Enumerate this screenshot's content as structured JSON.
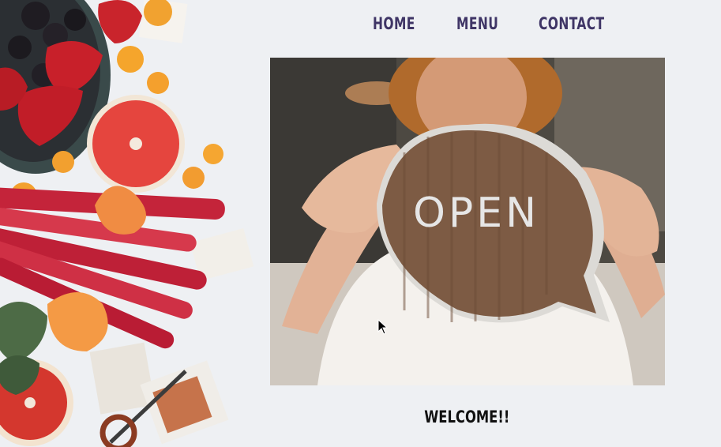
{
  "nav": {
    "items": [
      {
        "label": "HOME"
      },
      {
        "label": "MENU"
      },
      {
        "label": "CONTACT"
      }
    ],
    "color": "#3f3566"
  },
  "hero": {
    "sign_text": "OPEN"
  },
  "welcome": {
    "text": "WELCOME!!"
  }
}
